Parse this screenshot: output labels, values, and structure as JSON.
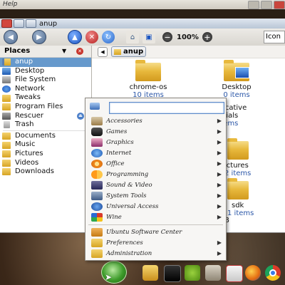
{
  "background_window": {
    "menu_label": "Help"
  },
  "window": {
    "title": "anup",
    "toolbar": {
      "zoom": "100%",
      "view_mode": "Icon"
    }
  },
  "sidebar": {
    "header": "Places",
    "items": [
      {
        "label": "anup",
        "icon": "home-folder-icon",
        "selected": true
      },
      {
        "label": "Desktop",
        "icon": "desktop-icon"
      },
      {
        "label": "File System",
        "icon": "disk-icon"
      },
      {
        "label": "Network",
        "icon": "network-icon"
      },
      {
        "label": "Tweaks",
        "icon": "folder-icon"
      },
      {
        "label": "Program Files",
        "icon": "folder-icon"
      },
      {
        "label": "Rescuer",
        "icon": "drive-icon",
        "eject": true
      },
      {
        "label": "Trash",
        "icon": "trash-icon"
      },
      {
        "label": "Documents",
        "icon": "folder-icon"
      },
      {
        "label": "Music",
        "icon": "folder-icon"
      },
      {
        "label": "Pictures",
        "icon": "folder-icon"
      },
      {
        "label": "Videos",
        "icon": "folder-icon"
      },
      {
        "label": "Downloads",
        "icon": "folder-icon"
      }
    ]
  },
  "content": {
    "path_button": "anup",
    "items": [
      {
        "name": "chrome-os",
        "count": "10 items"
      },
      {
        "name": "Desktop",
        "count": "0 items"
      },
      {
        "name": "educative",
        "count": ""
      },
      {
        "name": "aterials",
        "count": "3 items"
      },
      {
        "name": "ictures",
        "count": "2 items"
      },
      {
        "name": "sdk",
        "count": "1 items"
      },
      {
        "name": "B",
        "count": ""
      }
    ]
  },
  "app_menu": {
    "search_placeholder": "",
    "categories": [
      {
        "label": "Accessories"
      },
      {
        "label": "Games"
      },
      {
        "label": "Graphics"
      },
      {
        "label": "Internet"
      },
      {
        "label": "Office"
      },
      {
        "label": "Programming"
      },
      {
        "label": "Sound & Video"
      },
      {
        "label": "System Tools"
      },
      {
        "label": "Universal Access"
      },
      {
        "label": "Wine"
      }
    ],
    "extras": [
      {
        "label": "Ubuntu Software Center"
      },
      {
        "label": "Preferences"
      },
      {
        "label": "Administration"
      }
    ]
  }
}
